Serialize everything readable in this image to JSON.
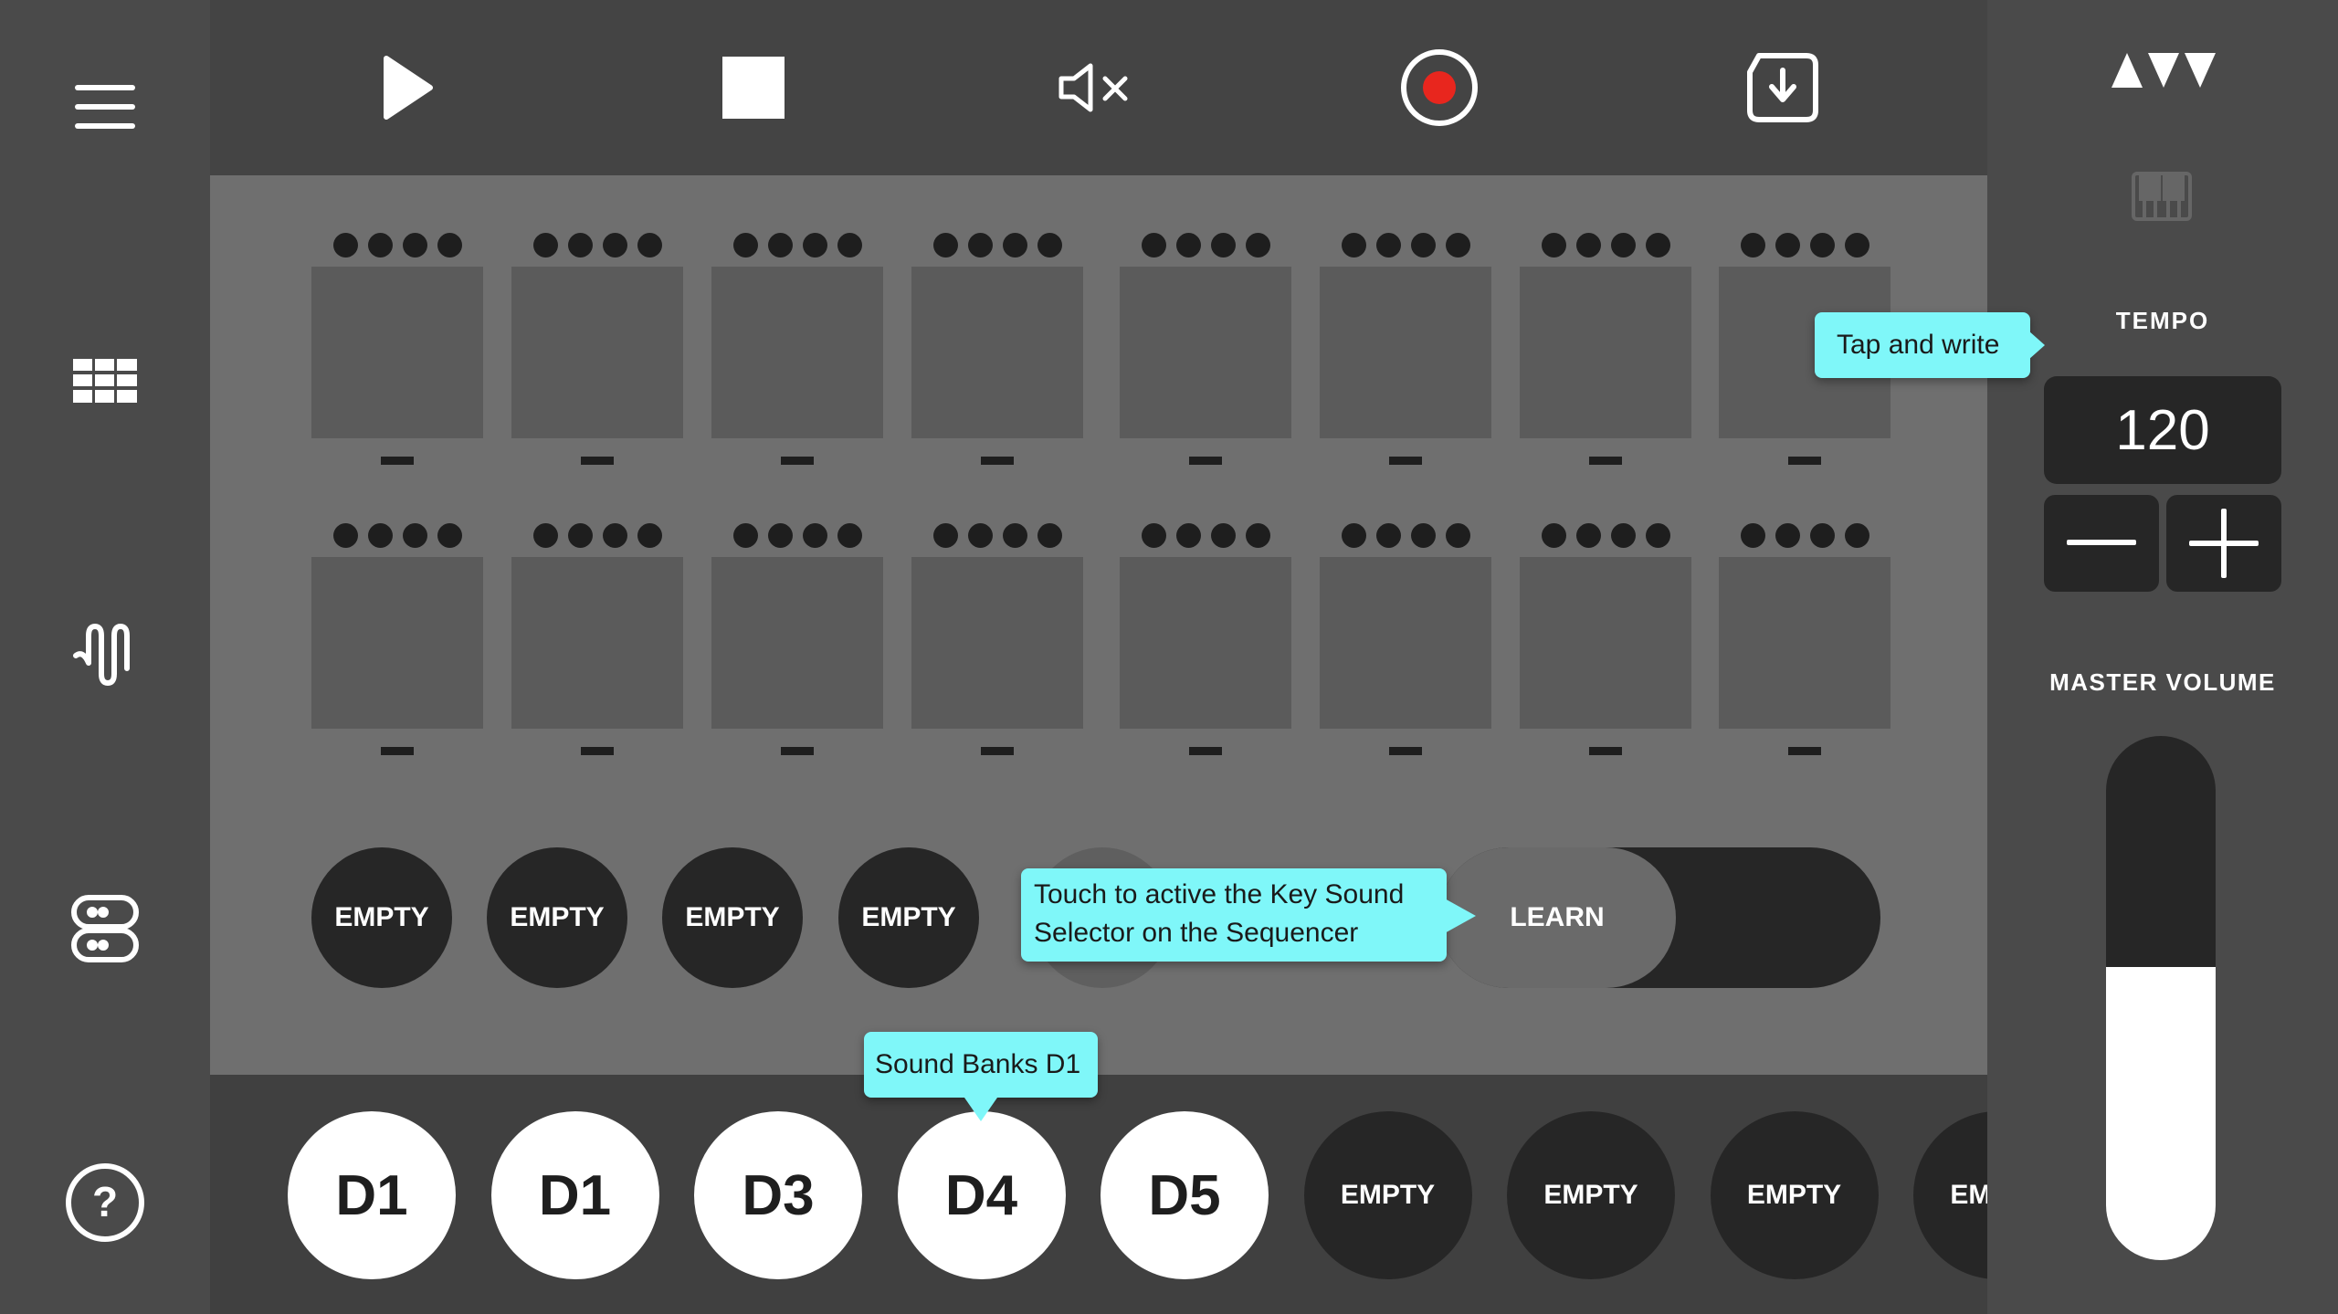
{
  "toolbar": {
    "play_icon": "play-icon",
    "stop_icon": "stop-icon",
    "mute_icon": "mute-icon",
    "record_icon": "record-icon",
    "save_icon": "download-icon",
    "record_color": "#e8261e"
  },
  "sidebar": {
    "items": [
      "menu-icon",
      "grid-icon",
      "waveform-icon",
      "sequencer-icon",
      "help-icon"
    ],
    "help_glyph": "?"
  },
  "pads": {
    "rows": 2,
    "cols": 8
  },
  "key_sounds": [
    "EMPTY",
    "EMPTY",
    "EMPTY",
    "EMPTY"
  ],
  "learn": {
    "label": "LEARN"
  },
  "banks": [
    {
      "label": "D1",
      "filled": true
    },
    {
      "label": "D1",
      "filled": true
    },
    {
      "label": "D3",
      "filled": true
    },
    {
      "label": "D4",
      "filled": true
    },
    {
      "label": "D5",
      "filled": true
    },
    {
      "label": "EMPTY",
      "filled": false
    },
    {
      "label": "EMPTY",
      "filled": false
    },
    {
      "label": "EMPTY",
      "filled": false
    },
    {
      "label": "EMPTY",
      "filled": false
    }
  ],
  "right_panel": {
    "logo": "logo-icon",
    "keyboard_icon": "keyboard-icon",
    "tempo_label": "TEMPO",
    "tempo_value": "120",
    "master_volume_label": "MASTER VOLUME",
    "master_volume_level": 0.56
  },
  "tooltips": {
    "tempo": "Tap and write",
    "learn_line1": "Touch to active the Key Sound",
    "learn_line2": "Selector on the Sequencer",
    "banks": "Sound Banks D1"
  },
  "colors": {
    "tooltip": "#7ff7f9",
    "accent_record": "#e8261e"
  }
}
